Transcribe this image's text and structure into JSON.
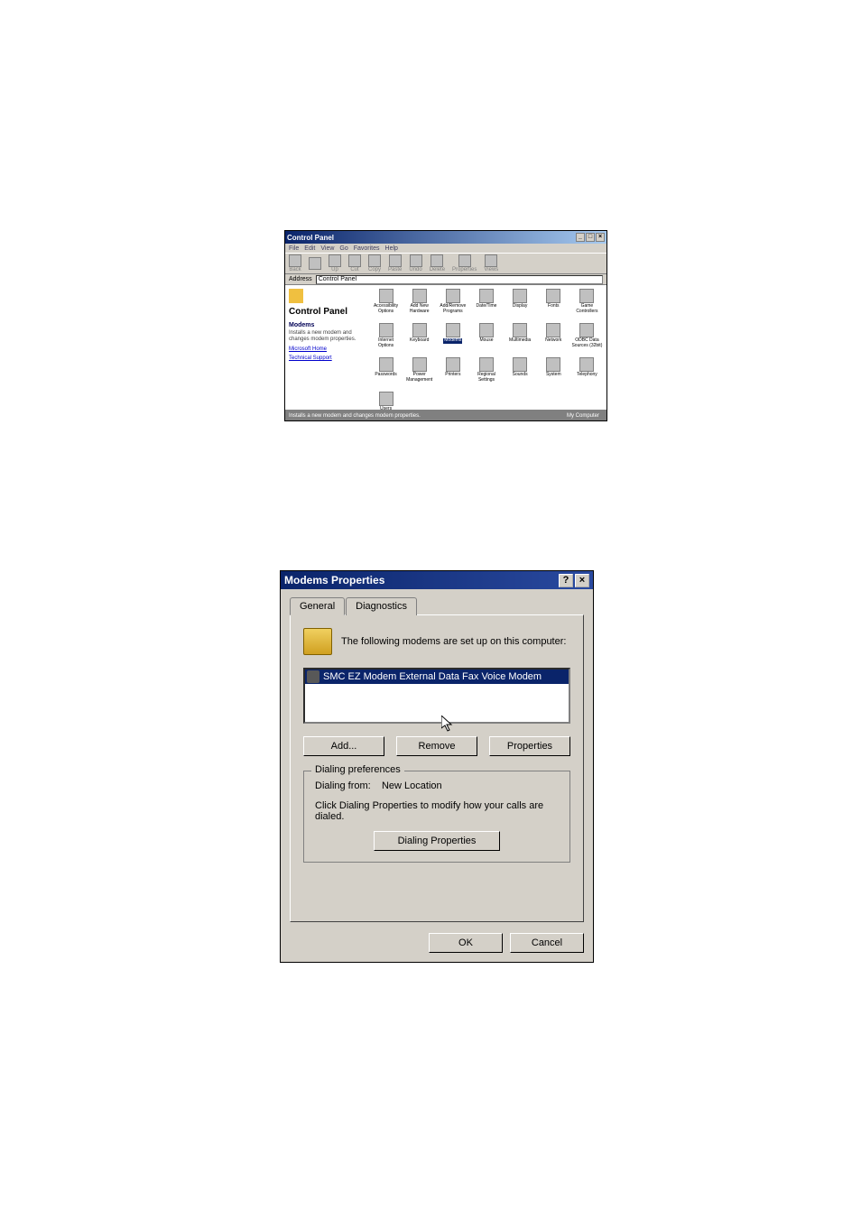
{
  "control_panel": {
    "title": "Control Panel",
    "menus": [
      "File",
      "Edit",
      "View",
      "Go",
      "Favorites",
      "Help"
    ],
    "toolbar": [
      {
        "label": "Back"
      },
      {
        "label": ""
      },
      {
        "label": "Up"
      },
      {
        "label": "Cut"
      },
      {
        "label": "Copy"
      },
      {
        "label": "Paste"
      },
      {
        "label": "Undo"
      },
      {
        "label": "Delete"
      },
      {
        "label": "Properties"
      },
      {
        "label": "Views"
      }
    ],
    "address_label": "Address",
    "address_value": "Control Panel",
    "side": {
      "heading": "Control Panel",
      "selected_title": "Modems",
      "description": "Installs a new modem and changes modem properties.",
      "links": [
        "Microsoft Home",
        "Technical Support"
      ]
    },
    "icons": [
      "Accessibility Options",
      "Add New Hardware",
      "Add/Remove Programs",
      "Date/Time",
      "Display",
      "Fonts",
      "Game Controllers",
      "Internet Options",
      "Keyboard",
      "Modems",
      "Mouse",
      "Multimedia",
      "Network",
      "ODBC Data Sources (32bit)",
      "Passwords",
      "Power Management",
      "Printers",
      "Regional Settings",
      "Sounds",
      "System",
      "Telephony",
      "Users"
    ],
    "selected_icon_index": 9,
    "status_left": "Installs a new modem and changes modem properties.",
    "status_right": "My Computer"
  },
  "modems_dialog": {
    "title": "Modems Properties",
    "tabs": [
      "General",
      "Diagnostics"
    ],
    "active_tab": 0,
    "info_text": "The following modems are set up on this computer:",
    "modem_list": [
      "SMC EZ Modem External Data Fax Voice Modem"
    ],
    "selected_modem_index": 0,
    "buttons": {
      "add": "Add...",
      "remove": "Remove",
      "properties": "Properties"
    },
    "group": {
      "legend": "Dialing preferences",
      "from_label": "Dialing from:",
      "from_value": "New Location",
      "hint": "Click Dialing Properties to modify how your calls are dialed.",
      "dialing_props": "Dialing Properties"
    },
    "footer": {
      "ok": "OK",
      "cancel": "Cancel"
    }
  }
}
